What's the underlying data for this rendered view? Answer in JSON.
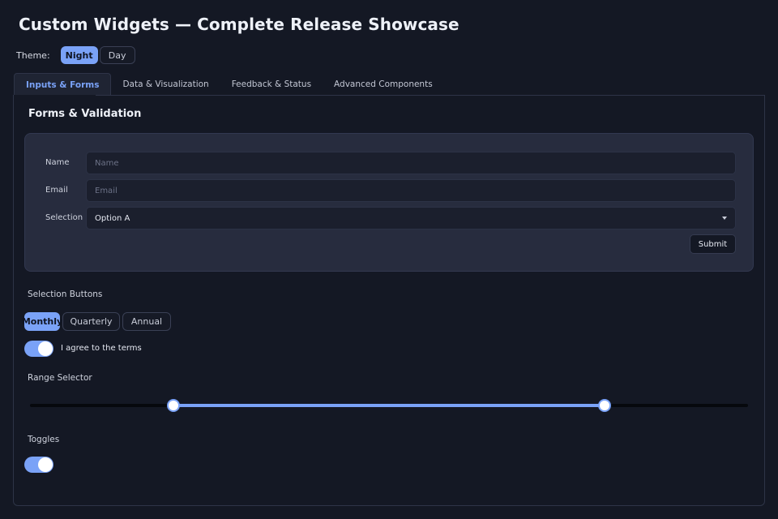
{
  "title": "Custom Widgets — Complete Release Showcase",
  "theme": {
    "label": "Theme:",
    "options": [
      "Night",
      "Day"
    ],
    "selected": "Night"
  },
  "tabs": [
    {
      "label": "Inputs & Forms",
      "active": true
    },
    {
      "label": "Data & Visualization",
      "active": false
    },
    {
      "label": "Feedback & Status",
      "active": false
    },
    {
      "label": "Advanced Components",
      "active": false
    }
  ],
  "forms": {
    "section_title": "Forms & Validation",
    "name": {
      "label": "Name",
      "placeholder": "Name",
      "value": ""
    },
    "email": {
      "label": "Email",
      "placeholder": "Email",
      "value": ""
    },
    "selection": {
      "label": "Selection",
      "value": "Option A"
    },
    "submit_label": "Submit"
  },
  "selection_buttons": {
    "heading": "Selection Buttons",
    "options": [
      "Monthly",
      "Quarterly",
      "Annual"
    ],
    "selected": "Monthly"
  },
  "agree": {
    "label": "I agree to the terms",
    "checked": true
  },
  "range": {
    "heading": "Range Selector",
    "low": 0.2,
    "high": 0.8
  },
  "toggles": {
    "heading": "Toggles",
    "state": true
  },
  "colors": {
    "accent": "#7aa2f7",
    "background": "#141824",
    "card": "#272c3e"
  }
}
